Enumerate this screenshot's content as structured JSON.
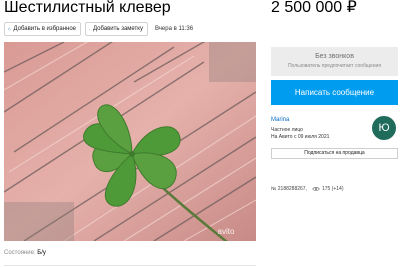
{
  "listing": {
    "title": "Шестилистный клевер",
    "price": "2 500 000 ₽",
    "favorite_label": "Добавить в избранное",
    "note_label": "Добавить заметку",
    "date": "Вчера в 11:36",
    "condition_label": "Состояние:",
    "condition_value": "Б/у",
    "photo_watermark": "avito"
  },
  "contact": {
    "no_calls_title": "Без звонков",
    "no_calls_subtitle": "Пользователь предпочитает сообщения",
    "write_button": "Написать сообщение"
  },
  "seller": {
    "name": "Marina",
    "type": "Частное лицо",
    "since": "На Авито с 09 июля 2021",
    "avatar_letter": "Ю",
    "avatar_color": "#1f6b5c",
    "subscribe_button": "Подписаться на продавца"
  },
  "meta": {
    "ad_number": "№ 2188288267,",
    "views": "175 (+14)"
  },
  "colors": {
    "accent": "#009cf0",
    "link": "#0a6bc7"
  },
  "icons": [
    "heart-icon",
    "note-icon",
    "eye-icon"
  ]
}
